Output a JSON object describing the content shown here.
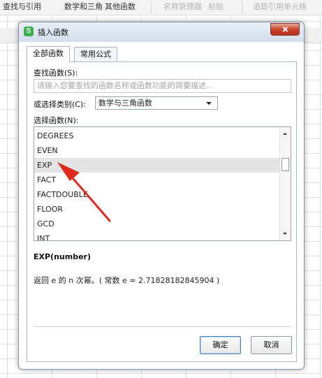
{
  "ribbon": {
    "items": [
      "查找与引用",
      "数学和三角",
      "其他函数",
      "名称管理器",
      "粘贴",
      "追踪引用单元格"
    ]
  },
  "dialog": {
    "title": "插入函数",
    "app_icon_letter": "S",
    "tabs": [
      "全部函数",
      "常用公式"
    ],
    "active_tab": "全部函数",
    "search": {
      "label": "查找函数(S):",
      "placeholder": "请输入您要查找的函数名称或函数功能的简要描述..."
    },
    "category": {
      "label": "或选择类别(C):",
      "selected": "数学与三角函数"
    },
    "function_list": {
      "label": "选择函数(N):",
      "items": [
        "DEGREES",
        "EVEN",
        "EXP",
        "FACT",
        "FACTDOUBLE",
        "FLOOR",
        "GCD",
        "INT"
      ],
      "selected": "EXP"
    },
    "syntax": "EXP(number)",
    "description": "返回 e 的 n 次幂。( 常数 e = 2.71828182845904 )",
    "ok_label": "确定",
    "cancel_label": "取消"
  },
  "colors": {
    "annotation_arrow": "#e02a1c",
    "selected_row": "#e4e4e4",
    "app_icon": "#3cb04a",
    "close_button": "#c6452f"
  }
}
